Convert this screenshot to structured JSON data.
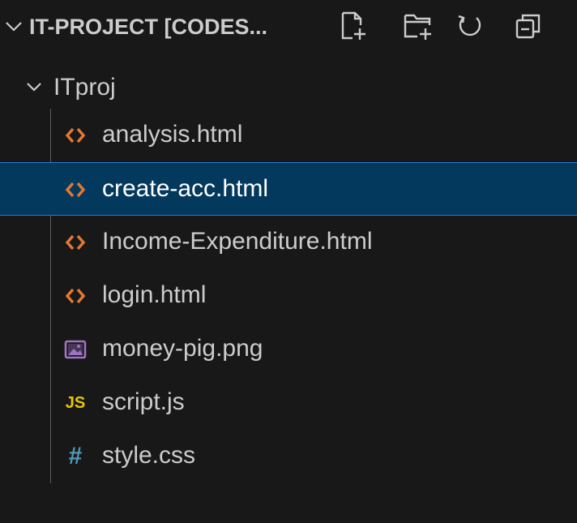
{
  "colors": {
    "background": "#181818",
    "text": "#cccccc",
    "selected_bg": "#04395e",
    "selected_border": "#2b79d1",
    "html_icon": "#e37933",
    "image_icon": "#a074c4",
    "js_icon": "#e8c800",
    "css_icon": "#519aba"
  },
  "header": {
    "title": "IT-PROJECT [CODES...",
    "actions": [
      {
        "name": "new-file-icon",
        "icon": "new-file"
      },
      {
        "name": "new-folder-icon",
        "icon": "new-folder"
      },
      {
        "name": "refresh-icon",
        "icon": "refresh"
      },
      {
        "name": "collapse-all-icon",
        "icon": "collapse-all"
      }
    ]
  },
  "folder": {
    "label": "ITproj",
    "expanded": true
  },
  "files": [
    {
      "label": "analysis.html",
      "icon": "html-icon",
      "selected": false
    },
    {
      "label": "create-acc.html",
      "icon": "html-icon",
      "selected": true
    },
    {
      "label": "Income-Expenditure.html",
      "icon": "html-icon",
      "selected": false
    },
    {
      "label": "login.html",
      "icon": "html-icon",
      "selected": false
    },
    {
      "label": "money-pig.png",
      "icon": "image-icon",
      "selected": false
    },
    {
      "label": "script.js",
      "icon": "js-icon",
      "selected": false,
      "badge": "JS"
    },
    {
      "label": "style.css",
      "icon": "css-icon",
      "selected": false,
      "badge": "#"
    }
  ]
}
